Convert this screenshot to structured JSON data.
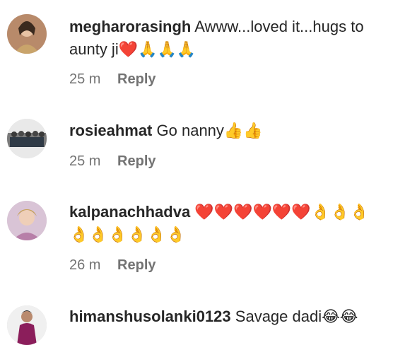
{
  "comments": [
    {
      "username": "megharorasingh",
      "text": "Awww...loved it...hugs to aunty ji❤️🙏🙏🙏",
      "time": "25 m",
      "reply_label": "Reply"
    },
    {
      "username": "rosieahmat",
      "text": "Go nanny👍👍",
      "time": "25 m",
      "reply_label": "Reply"
    },
    {
      "username": "kalpanachhadva",
      "text": "❤️❤️❤️❤️❤️❤️👌👌👌👌👌👌👌👌👌",
      "time": "26 m",
      "reply_label": "Reply"
    },
    {
      "username": "himanshusolanki0123",
      "text": "Savage dadi😂😂",
      "time": "",
      "reply_label": ""
    }
  ]
}
